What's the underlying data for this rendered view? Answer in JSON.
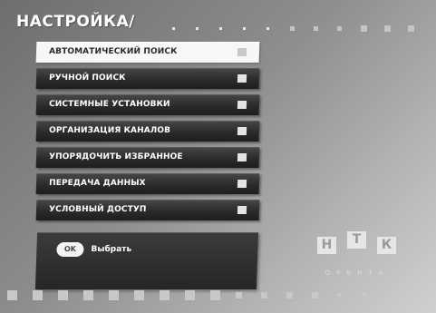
{
  "header": {
    "title": "НАСТРОЙКА/"
  },
  "menu": {
    "items": [
      {
        "label": "АВТОМАТИЧЕСКИЙ ПОИСК",
        "selected": true
      },
      {
        "label": "РУЧНОЙ ПОИСК",
        "selected": false
      },
      {
        "label": "СИСТЕМНЫЕ УСТАНОВКИ",
        "selected": false
      },
      {
        "label": "ОРГАНИЗАЦИЯ КАНАЛОВ",
        "selected": false
      },
      {
        "label": "УПОРЯДОЧИТЬ ИЗБРАННОЕ",
        "selected": false
      },
      {
        "label": "ПЕРЕДАЧА ДАННЫХ",
        "selected": false
      },
      {
        "label": "УСЛОВНЫЙ ДОСТУП",
        "selected": false
      }
    ]
  },
  "hint": {
    "button_label": "OK",
    "action_text": "Выбрать"
  },
  "logo": {
    "letters": [
      "Н",
      "Т",
      "К"
    ],
    "subtitle": "ОРБИТА"
  },
  "colors": {
    "menu_item_bg": "#2a2a2a",
    "selected_item_bg": "#f7f7f7",
    "text_light": "#ffffff",
    "text_dark": "#2a2a2a",
    "background": "#8e8e8e"
  }
}
